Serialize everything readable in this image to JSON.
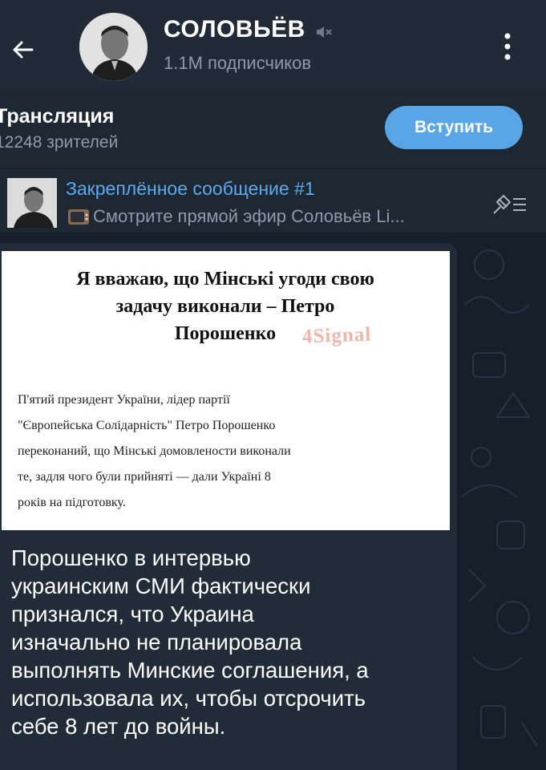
{
  "header": {
    "back_icon": "arrow-left-icon",
    "title": "СОЛОВЬЁВ",
    "muted_icon": "muted-speaker-icon",
    "subscribers": "1.1M подписчиков",
    "menu_icon": "more-vertical-icon"
  },
  "live": {
    "title": "Трансляция",
    "viewers": "12248 зрителей",
    "join_label": "Вступить"
  },
  "pinned": {
    "title": "Закреплённое сообщение #1",
    "text": "Смотрите прямой эфир Соловьёв Li...",
    "tv_icon": "tv-emoji-icon",
    "list_icon": "pinned-list-icon"
  },
  "message": {
    "image": {
      "headline": [
        "Я вважаю, що Мінські угоди свою",
        "задачу виконали – Петро",
        "Порошенко"
      ],
      "watermark": "4Signal",
      "body": [
        "П'ятий президент України, лідер партії",
        "\"Європейська Солідарність\" Петро Порошенко",
        "переконаний, що Мінські домовлености виконали",
        "те, задля чого були прийняті — дали Україні 8",
        "років на підготовку."
      ]
    },
    "text_lines": [
      "Порошенко в интервью",
      "украинским СМИ фактически",
      "признался, что Украина",
      "изначально не планировала",
      "выполнять Минские соглашения, а",
      "использовала их, чтобы отсрочить",
      "себе 8 лет до войны."
    ]
  },
  "colors": {
    "background": "#1b2430",
    "accent": "#5aa5e6",
    "link": "#5ea8ec",
    "muted_text": "#8f9aa6"
  }
}
